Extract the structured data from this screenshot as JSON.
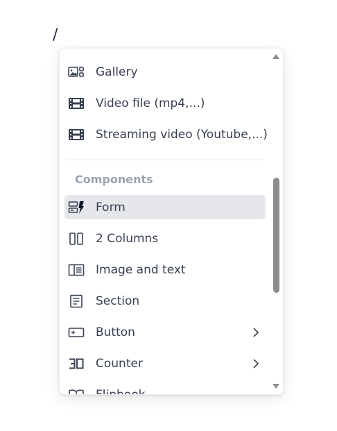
{
  "editor": {
    "slash_text": "/"
  },
  "menu": {
    "media_items": [
      {
        "label": "Gallery",
        "icon": "gallery-icon"
      },
      {
        "label": "Video file (mp4,...)",
        "icon": "film-icon"
      },
      {
        "label": "Streaming video (Youtube,...)",
        "icon": "film-icon"
      }
    ],
    "components_header": "Components",
    "component_items": [
      {
        "label": "Form",
        "icon": "form-icon",
        "active": true
      },
      {
        "label": "2 Columns",
        "icon": "two-columns-icon"
      },
      {
        "label": "Image and text",
        "icon": "image-and-text-icon"
      },
      {
        "label": "Section",
        "icon": "section-icon"
      },
      {
        "label": "Button",
        "icon": "button-icon",
        "submenu": true
      },
      {
        "label": "Counter",
        "icon": "counter-icon",
        "submenu": true
      },
      {
        "label": "Flipbook",
        "icon": "book-icon"
      }
    ]
  },
  "colors": {
    "active_bg": "#e5e7eb",
    "text": "#374151",
    "header": "#9ca3af",
    "scroll_thumb": "#8d8d8d"
  }
}
